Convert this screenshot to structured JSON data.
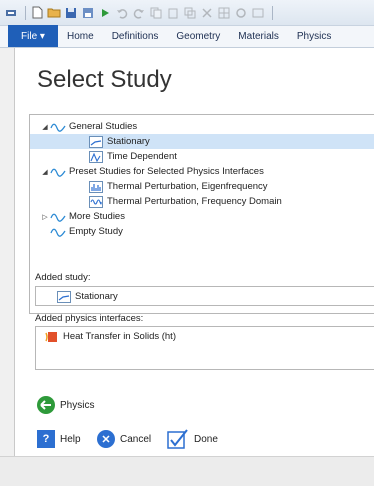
{
  "ribbon": {
    "file_label": "File ▾",
    "tabs": [
      "Home",
      "Definitions",
      "Geometry",
      "Materials",
      "Physics"
    ]
  },
  "page_title": "Select Study",
  "tree": {
    "general_studies": "General Studies",
    "stationary": "Stationary",
    "time_dependent": "Time Dependent",
    "preset_studies": "Preset Studies for Selected Physics Interfaces",
    "thermal_eigen": "Thermal Perturbation, Eigenfrequency",
    "thermal_freq": "Thermal Perturbation, Frequency Domain",
    "more_studies": "More Studies",
    "empty_study": "Empty Study"
  },
  "added_study": {
    "label": "Added study:",
    "value": "Stationary"
  },
  "added_physics": {
    "label": "Added physics interfaces:",
    "items": [
      "Heat Transfer in Solids (ht)"
    ]
  },
  "buttons": {
    "physics": "Physics",
    "help": "Help",
    "cancel": "Cancel",
    "done": "Done"
  },
  "colors": {
    "file_tab": "#1f5fb8",
    "selection": "#cfe3f7",
    "green": "#2e9a3a",
    "blue": "#2c6fd1"
  }
}
